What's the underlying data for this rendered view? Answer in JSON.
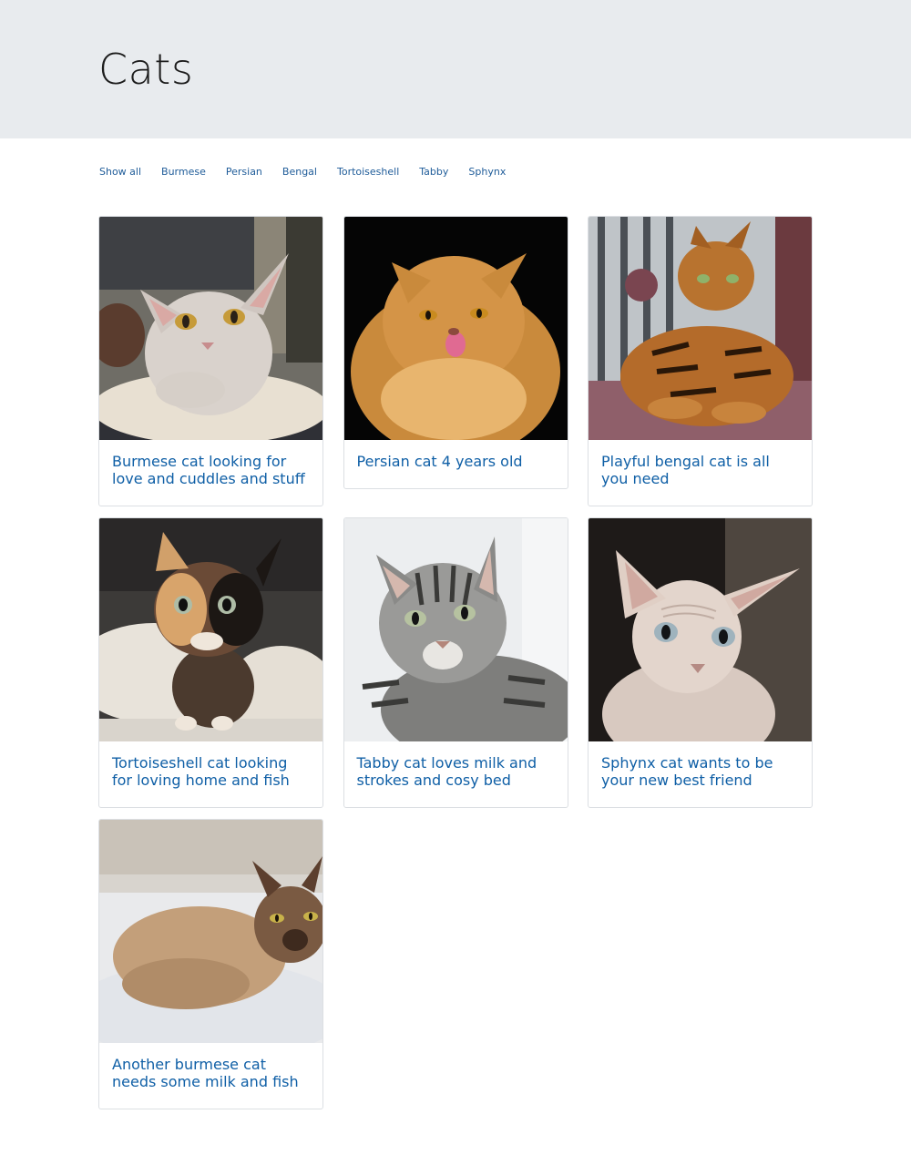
{
  "header": {
    "title": "Cats"
  },
  "filters": [
    {
      "label": "Show all"
    },
    {
      "label": "Burmese"
    },
    {
      "label": "Persian"
    },
    {
      "label": "Bengal"
    },
    {
      "label": "Tortoiseshell"
    },
    {
      "label": "Tabby"
    },
    {
      "label": "Sphynx"
    }
  ],
  "cards": [
    {
      "title": "Burmese cat looking for love and cuddles and stuff",
      "image": "burmese-cat-photo",
      "breed": "Burmese"
    },
    {
      "title": "Persian cat 4 years old",
      "image": "persian-cat-photo",
      "breed": "Persian"
    },
    {
      "title": "Playful bengal cat is all you need",
      "image": "bengal-cat-photo",
      "breed": "Bengal"
    },
    {
      "title": "Tortoiseshell cat looking for loving home and fish",
      "image": "tortoiseshell-cat-photo",
      "breed": "Tortoiseshell"
    },
    {
      "title": "Tabby cat loves milk and strokes and cosy bed",
      "image": "tabby-cat-photo",
      "breed": "Tabby"
    },
    {
      "title": "Sphynx cat wants to be your new best friend",
      "image": "sphynx-cat-photo",
      "breed": "Sphynx"
    },
    {
      "title": "Another burmese cat needs some milk and fish",
      "image": "burmese-cat-photo-2",
      "breed": "Burmese"
    }
  ],
  "colors": {
    "header_bg": "#e8ebee",
    "link": "#1f5c99",
    "card_title": "#0f5fa6",
    "card_border": "#dcdfe3"
  }
}
